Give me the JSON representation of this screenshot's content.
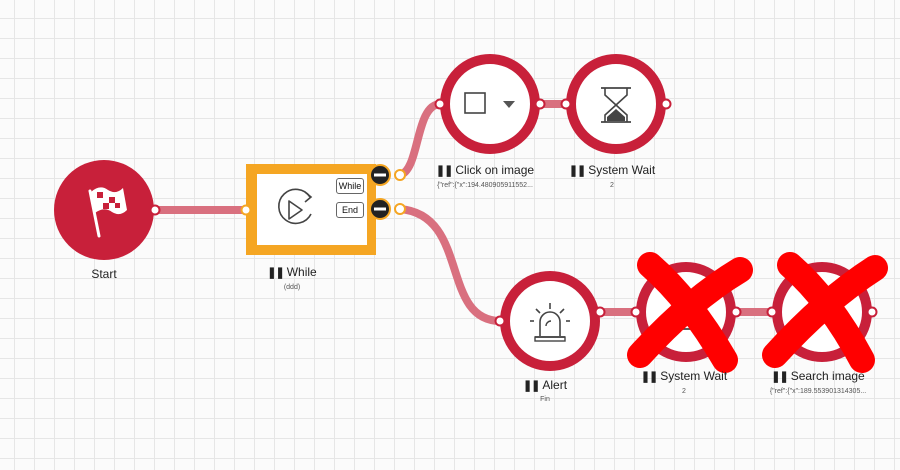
{
  "nodes": {
    "start": {
      "title": "Start",
      "icon": "checkered-flag-icon"
    },
    "while": {
      "title": "While",
      "subtitle": "(ddd)",
      "icon": "loop-play-icon",
      "branch_while": "While",
      "branch_end": "End"
    },
    "click_image": {
      "title": "Click on image",
      "subtitle": "{\"ref\":{\"x\":194.480905911552...",
      "icon": "mouse-click-dropdown-icon"
    },
    "system_wait_1": {
      "title": "System Wait",
      "subtitle": "2",
      "icon": "hourglass-icon"
    },
    "alert": {
      "title": "Alert",
      "subtitle": "Fin",
      "icon": "siren-icon"
    },
    "system_wait_2": {
      "title": "System Wait",
      "subtitle": "2",
      "icon": "hourglass-icon",
      "disabled": true
    },
    "search_image": {
      "title": "Search image",
      "subtitle": "{\"ref\":{\"x\":189.553901314305...",
      "icon": "search-image-icon",
      "disabled": true
    }
  },
  "colors": {
    "node_red": "#c8203a",
    "connector": "#d9707f",
    "while_orange": "#f5a623",
    "cross_red": "#ff0000"
  }
}
